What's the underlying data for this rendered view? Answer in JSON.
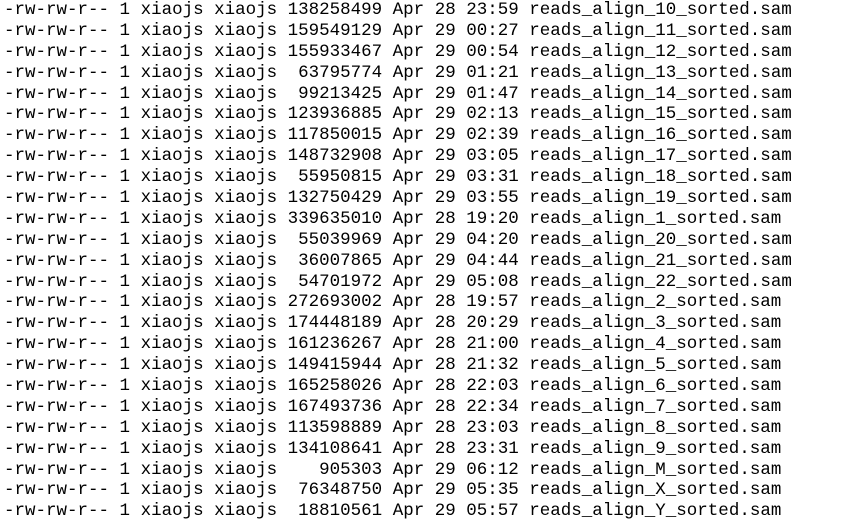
{
  "terminal": {
    "colors": {
      "background": "#ffffff",
      "text": "#000000"
    },
    "rows": [
      {
        "perms": "-rw-rw-r--",
        "links": "1",
        "owner": "xiaojs",
        "group": "xiaojs",
        "size": "138258499",
        "month": "Apr",
        "day": "28",
        "time": "23:59",
        "name": "reads_align_10_sorted.sam"
      },
      {
        "perms": "-rw-rw-r--",
        "links": "1",
        "owner": "xiaojs",
        "group": "xiaojs",
        "size": "159549129",
        "month": "Apr",
        "day": "29",
        "time": "00:27",
        "name": "reads_align_11_sorted.sam"
      },
      {
        "perms": "-rw-rw-r--",
        "links": "1",
        "owner": "xiaojs",
        "group": "xiaojs",
        "size": "155933467",
        "month": "Apr",
        "day": "29",
        "time": "00:54",
        "name": "reads_align_12_sorted.sam"
      },
      {
        "perms": "-rw-rw-r--",
        "links": "1",
        "owner": "xiaojs",
        "group": "xiaojs",
        "size": "63795774",
        "month": "Apr",
        "day": "29",
        "time": "01:21",
        "name": "reads_align_13_sorted.sam"
      },
      {
        "perms": "-rw-rw-r--",
        "links": "1",
        "owner": "xiaojs",
        "group": "xiaojs",
        "size": "99213425",
        "month": "Apr",
        "day": "29",
        "time": "01:47",
        "name": "reads_align_14_sorted.sam"
      },
      {
        "perms": "-rw-rw-r--",
        "links": "1",
        "owner": "xiaojs",
        "group": "xiaojs",
        "size": "123936885",
        "month": "Apr",
        "day": "29",
        "time": "02:13",
        "name": "reads_align_15_sorted.sam"
      },
      {
        "perms": "-rw-rw-r--",
        "links": "1",
        "owner": "xiaojs",
        "group": "xiaojs",
        "size": "117850015",
        "month": "Apr",
        "day": "29",
        "time": "02:39",
        "name": "reads_align_16_sorted.sam"
      },
      {
        "perms": "-rw-rw-r--",
        "links": "1",
        "owner": "xiaojs",
        "group": "xiaojs",
        "size": "148732908",
        "month": "Apr",
        "day": "29",
        "time": "03:05",
        "name": "reads_align_17_sorted.sam"
      },
      {
        "perms": "-rw-rw-r--",
        "links": "1",
        "owner": "xiaojs",
        "group": "xiaojs",
        "size": "55950815",
        "month": "Apr",
        "day": "29",
        "time": "03:31",
        "name": "reads_align_18_sorted.sam"
      },
      {
        "perms": "-rw-rw-r--",
        "links": "1",
        "owner": "xiaojs",
        "group": "xiaojs",
        "size": "132750429",
        "month": "Apr",
        "day": "29",
        "time": "03:55",
        "name": "reads_align_19_sorted.sam"
      },
      {
        "perms": "-rw-rw-r--",
        "links": "1",
        "owner": "xiaojs",
        "group": "xiaojs",
        "size": "339635010",
        "month": "Apr",
        "day": "28",
        "time": "19:20",
        "name": "reads_align_1_sorted.sam"
      },
      {
        "perms": "-rw-rw-r--",
        "links": "1",
        "owner": "xiaojs",
        "group": "xiaojs",
        "size": "55039969",
        "month": "Apr",
        "day": "29",
        "time": "04:20",
        "name": "reads_align_20_sorted.sam"
      },
      {
        "perms": "-rw-rw-r--",
        "links": "1",
        "owner": "xiaojs",
        "group": "xiaojs",
        "size": "36007865",
        "month": "Apr",
        "day": "29",
        "time": "04:44",
        "name": "reads_align_21_sorted.sam"
      },
      {
        "perms": "-rw-rw-r--",
        "links": "1",
        "owner": "xiaojs",
        "group": "xiaojs",
        "size": "54701972",
        "month": "Apr",
        "day": "29",
        "time": "05:08",
        "name": "reads_align_22_sorted.sam"
      },
      {
        "perms": "-rw-rw-r--",
        "links": "1",
        "owner": "xiaojs",
        "group": "xiaojs",
        "size": "272693002",
        "month": "Apr",
        "day": "28",
        "time": "19:57",
        "name": "reads_align_2_sorted.sam"
      },
      {
        "perms": "-rw-rw-r--",
        "links": "1",
        "owner": "xiaojs",
        "group": "xiaojs",
        "size": "174448189",
        "month": "Apr",
        "day": "28",
        "time": "20:29",
        "name": "reads_align_3_sorted.sam"
      },
      {
        "perms": "-rw-rw-r--",
        "links": "1",
        "owner": "xiaojs",
        "group": "xiaojs",
        "size": "161236267",
        "month": "Apr",
        "day": "28",
        "time": "21:00",
        "name": "reads_align_4_sorted.sam"
      },
      {
        "perms": "-rw-rw-r--",
        "links": "1",
        "owner": "xiaojs",
        "group": "xiaojs",
        "size": "149415944",
        "month": "Apr",
        "day": "28",
        "time": "21:32",
        "name": "reads_align_5_sorted.sam"
      },
      {
        "perms": "-rw-rw-r--",
        "links": "1",
        "owner": "xiaojs",
        "group": "xiaojs",
        "size": "165258026",
        "month": "Apr",
        "day": "28",
        "time": "22:03",
        "name": "reads_align_6_sorted.sam"
      },
      {
        "perms": "-rw-rw-r--",
        "links": "1",
        "owner": "xiaojs",
        "group": "xiaojs",
        "size": "167493736",
        "month": "Apr",
        "day": "28",
        "time": "22:34",
        "name": "reads_align_7_sorted.sam"
      },
      {
        "perms": "-rw-rw-r--",
        "links": "1",
        "owner": "xiaojs",
        "group": "xiaojs",
        "size": "113598889",
        "month": "Apr",
        "day": "28",
        "time": "23:03",
        "name": "reads_align_8_sorted.sam"
      },
      {
        "perms": "-rw-rw-r--",
        "links": "1",
        "owner": "xiaojs",
        "group": "xiaojs",
        "size": "134108641",
        "month": "Apr",
        "day": "28",
        "time": "23:31",
        "name": "reads_align_9_sorted.sam"
      },
      {
        "perms": "-rw-rw-r--",
        "links": "1",
        "owner": "xiaojs",
        "group": "xiaojs",
        "size": "905303",
        "month": "Apr",
        "day": "29",
        "time": "06:12",
        "name": "reads_align_M_sorted.sam"
      },
      {
        "perms": "-rw-rw-r--",
        "links": "1",
        "owner": "xiaojs",
        "group": "xiaojs",
        "size": "76348750",
        "month": "Apr",
        "day": "29",
        "time": "05:35",
        "name": "reads_align_X_sorted.sam"
      },
      {
        "perms": "-rw-rw-r--",
        "links": "1",
        "owner": "xiaojs",
        "group": "xiaojs",
        "size": "18810561",
        "month": "Apr",
        "day": "29",
        "time": "05:57",
        "name": "reads_align_Y_sorted.sam"
      }
    ]
  }
}
